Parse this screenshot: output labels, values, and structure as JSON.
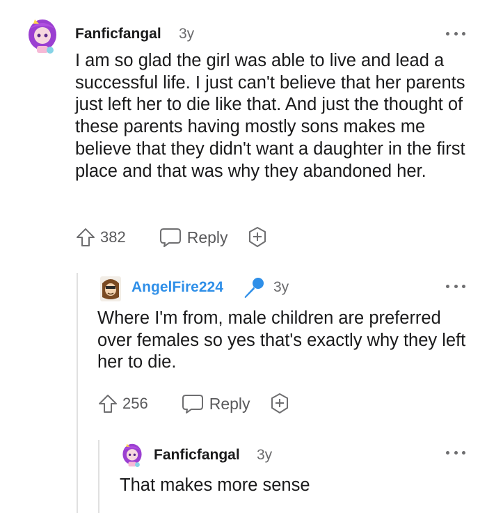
{
  "comments": [
    {
      "username": "Fanficfangal",
      "age": "3y",
      "body": "I am so glad the girl was able to live and lead a successful life. I just can't believe that her parents just left her to die like that. And just the thought of these parents having mostly sons makes me believe that they didn't want a daughter in the first place and that was why they abandoned her.",
      "upvotes": "382",
      "reply_label": "Reply"
    },
    {
      "username": "AngelFire224",
      "age": "3y",
      "body": "Where I'm from, male children are preferred over females so yes that's exactly why they left her to die.",
      "upvotes": "256",
      "reply_label": "Reply",
      "badge_icon": "microphone-icon",
      "accent": "#2f8fe8"
    },
    {
      "username": "Fanficfangal",
      "age": "3y",
      "body": "That makes more sense"
    }
  ],
  "icons": {
    "upvote": "upvote-arrow-icon",
    "reply": "speech-bubble-icon",
    "award": "award-plus-icon",
    "more": "more-dots-icon"
  }
}
